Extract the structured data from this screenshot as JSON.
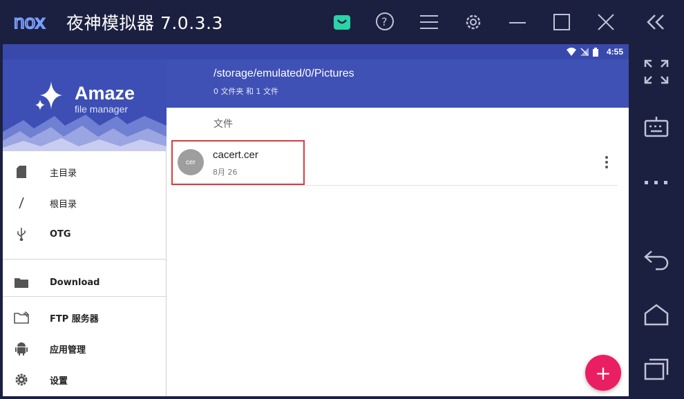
{
  "emulator": {
    "logo_text": "nox",
    "title": "夜神模拟器 7.0.3.3",
    "titlebar_icons": [
      "store-icon",
      "help-icon",
      "menu-icon",
      "settings-icon",
      "minimize-icon",
      "maximize-icon",
      "close-icon",
      "collapse-icon"
    ],
    "side_tools": [
      "fullscreen-icon",
      "keyboard-icon",
      "more-icon",
      "back-icon",
      "home-icon",
      "recent-apps-icon"
    ],
    "accent_color": "#1c2040"
  },
  "statusbar": {
    "time": "4:55"
  },
  "drawer": {
    "brand_name": "Amaze",
    "brand_sub": "file manager",
    "items": [
      {
        "label": "主目录",
        "icon": "sdcard-icon"
      },
      {
        "label": "根目录",
        "icon": "slash-icon"
      },
      {
        "label": "OTG",
        "icon": "usb-icon"
      },
      {
        "label": "Download",
        "icon": "folder-icon"
      },
      {
        "label": "FTP 服务器",
        "icon": "ftp-folder-icon"
      },
      {
        "label": "应用管理",
        "icon": "android-icon"
      },
      {
        "label": "设置",
        "icon": "gear-icon"
      }
    ]
  },
  "main": {
    "path": "/storage/emulated/0/Pictures",
    "summary": "0 文件夹 和 1 文件",
    "section_label": "文件",
    "files": [
      {
        "avatar": "cer",
        "name": "cacert.cer",
        "date": "8月 26"
      }
    ],
    "primary_color": "#3f51b5",
    "fab_label": "+",
    "fab_color": "#e91e63"
  }
}
